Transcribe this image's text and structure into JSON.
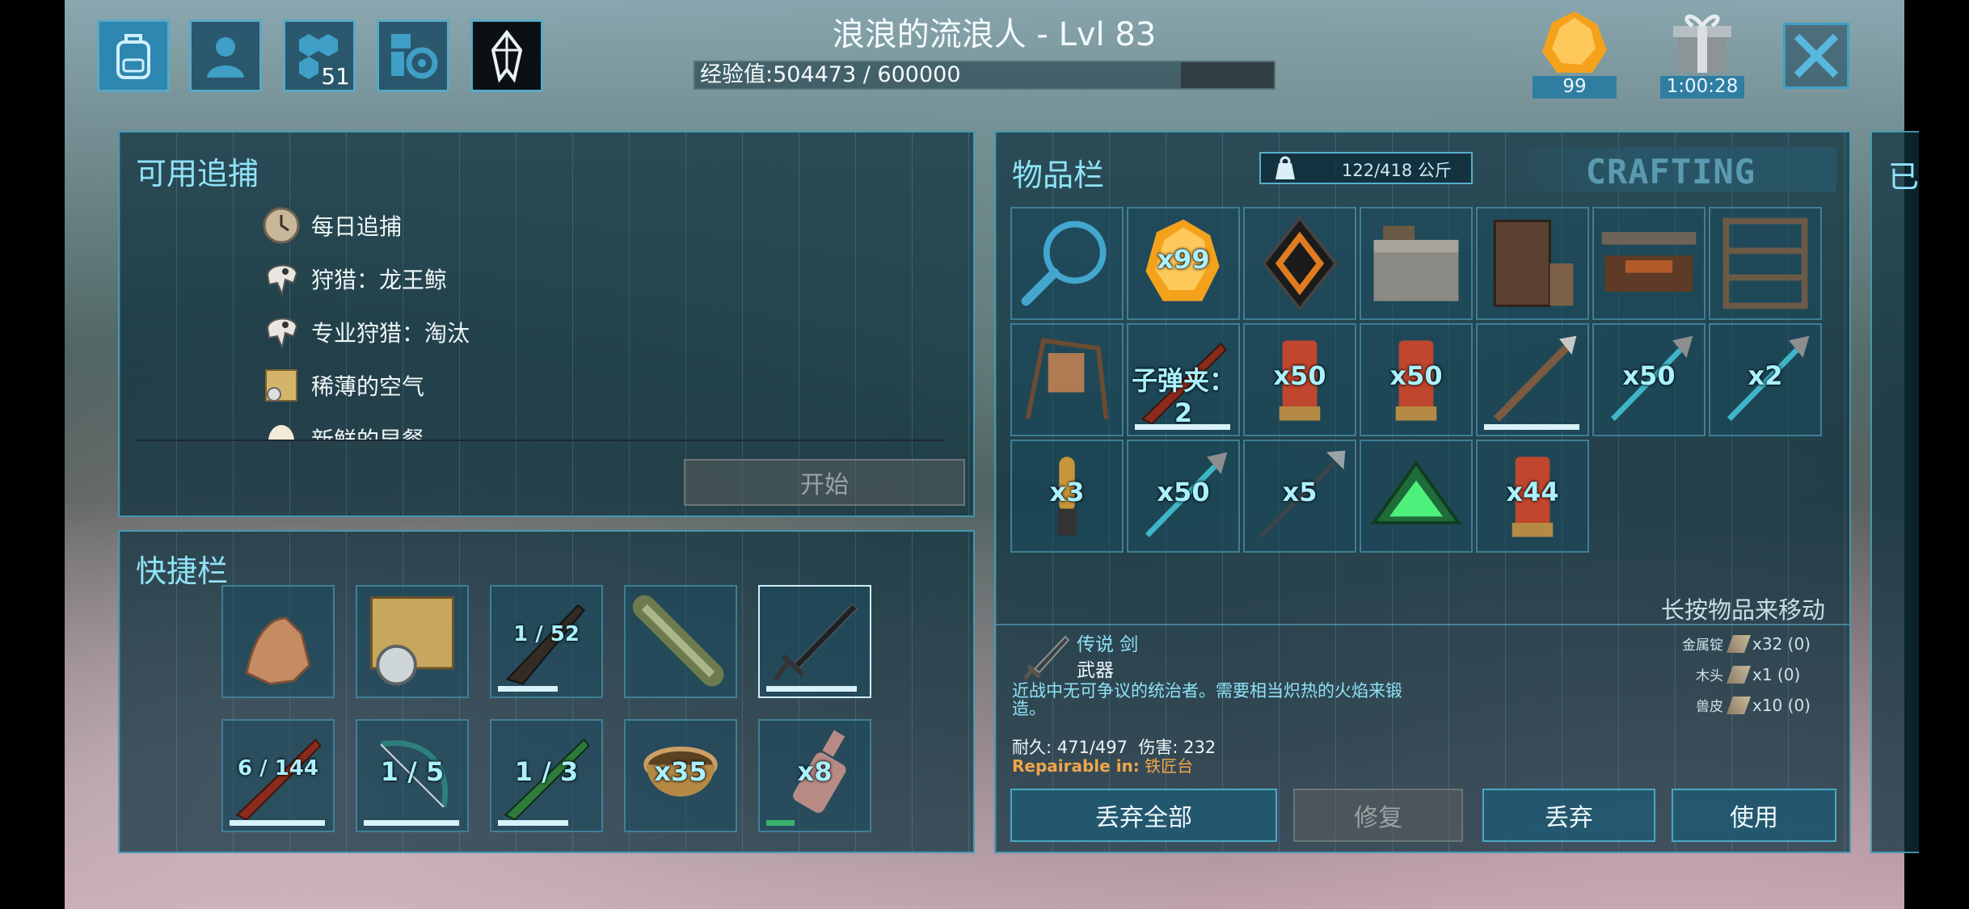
{
  "header": {
    "player_title": "浪浪的流浪人 - Lvl 83",
    "xp_label": "经验值:504473 / 600000",
    "xp_fraction": 0.84,
    "tabs": [
      {
        "icon": "backpack-icon",
        "badge": ""
      },
      {
        "icon": "character-icon",
        "badge": ""
      },
      {
        "icon": "engrams-icon",
        "badge": "51"
      },
      {
        "icon": "settings-icon",
        "badge": ""
      },
      {
        "icon": "crystal-icon",
        "badge": ""
      }
    ],
    "amber_count": "99",
    "gift_timer": "1:00:28"
  },
  "bounties": {
    "title": "可用追捕",
    "items": [
      "每日追捕",
      "狩猎：龙王鲸",
      "专业狩猎：淘汰",
      "稀薄的空气",
      "新鲜的早餐"
    ],
    "start_label": "开始"
  },
  "hotbar": {
    "title": "快捷栏",
    "slots": [
      {
        "icon": "hand-icon",
        "count": "",
        "bar": 0
      },
      {
        "icon": "map-compass-icon",
        "count": "",
        "bar": 0
      },
      {
        "icon": "shotgun-icon",
        "count": "1 / 52",
        "bar": 0.6
      },
      {
        "icon": "spyglass-icon",
        "count": "",
        "bar": 0
      },
      {
        "icon": "sword-icon",
        "count": "",
        "bar": 0.9
      },
      {
        "icon": "rifle-icon",
        "count": "6 / 144",
        "bar": 0.95
      },
      {
        "icon": "bow-icon",
        "count": "1 / 5",
        "bar": 0.95
      },
      {
        "icon": "green-rifle-icon",
        "count": "1 / 3",
        "bar": 0.7
      },
      {
        "icon": "bowl-icon",
        "count": "x35",
        "bar": 0
      },
      {
        "icon": "bottle-icon",
        "count": "x8",
        "bar": 0.28
      }
    ]
  },
  "inventory": {
    "title": "物品栏",
    "weight": "122/418 公斤",
    "crafting_label": "CRAFTING",
    "hint": "长按物品来移动",
    "slots": [
      {
        "icon": "search-icon",
        "count": "",
        "bar": 0
      },
      {
        "icon": "amber-icon",
        "count": "x99",
        "bar": 0
      },
      {
        "icon": "element-icon",
        "count": "",
        "bar": 0
      },
      {
        "icon": "kitchen-icon",
        "count": "",
        "bar": 0
      },
      {
        "icon": "cabinet-icon",
        "count": "",
        "bar": 0
      },
      {
        "icon": "workbench-icon",
        "count": "",
        "bar": 0
      },
      {
        "icon": "shelf-icon",
        "count": "",
        "bar": 0
      },
      {
        "icon": "tanning-rack-icon",
        "count": "",
        "bar": 0
      },
      {
        "icon": "rifle-icon",
        "count": "子弹夹：2",
        "bar": 0.95
      },
      {
        "icon": "shell-icon",
        "count": "x50",
        "bar": 0
      },
      {
        "icon": "shell-icon",
        "count": "x50",
        "bar": 0
      },
      {
        "icon": "pike-icon",
        "count": "",
        "bar": 0.95
      },
      {
        "icon": "arrow-icon",
        "count": "x50",
        "bar": 0
      },
      {
        "icon": "arrow-icon",
        "count": "x2",
        "bar": 0
      },
      {
        "icon": "bullet-icon",
        "count": "x3",
        "bar": 0
      },
      {
        "icon": "arrow-icon",
        "count": "x50",
        "bar": 0
      },
      {
        "icon": "spear-icon",
        "count": "x5",
        "bar": 0
      },
      {
        "icon": "tek-icon",
        "count": "",
        "bar": 0
      },
      {
        "icon": "shell-icon",
        "count": "x44",
        "bar": 0
      }
    ]
  },
  "item_detail": {
    "name": "传说 剑",
    "category": "武器",
    "description": "近战中无可争议的统治者。需要相当炽热的火焰来锻造。",
    "stats": "耐久: 471/497  伤害: 232",
    "repair_prefix": "Repairable in:",
    "repair_station": "铁匠台",
    "requirements": [
      {
        "name": "金属锭",
        "qty": "x32 (0)"
      },
      {
        "name": "木头",
        "qty": "x1 (0)"
      },
      {
        "name": "兽皮",
        "qty": "x10 (0)"
      }
    ]
  },
  "actions": {
    "drop_all": "丢弃全部",
    "repair": "修复",
    "drop": "丢弃",
    "use": "使用"
  },
  "right_panel_partial": "已",
  "colors": {
    "accent": "#8fe3f7",
    "panel": "#0e303e",
    "repair_orange": "#f0a64a"
  }
}
